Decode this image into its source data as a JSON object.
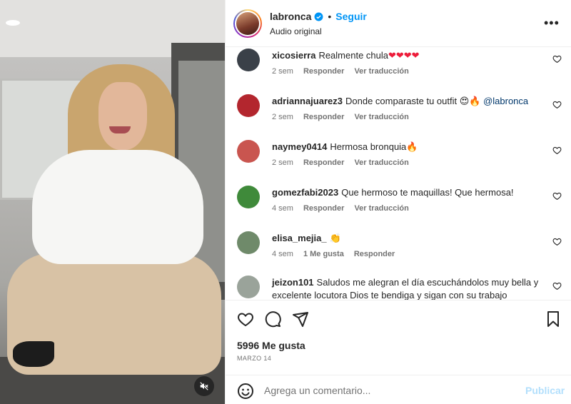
{
  "post": {
    "username": "labronca",
    "separator": "•",
    "follow_label": "Seguir",
    "audio_label": "Audio original",
    "more_label": "•••"
  },
  "comments": [
    {
      "user": "xicosierra",
      "text": "Realmente chula",
      "emoji": "❤❤❤❤",
      "time": "2 sem",
      "likes": "",
      "reply": "Responder",
      "translate": "Ver traducción",
      "avatar_color": "#3a4048"
    },
    {
      "user": "adriannajuarez3",
      "text": "Donde comparaste tu outfit 😍🔥",
      "mention": "@labronca",
      "time": "2 sem",
      "likes": "",
      "reply": "Responder",
      "translate": "Ver traducción",
      "avatar_color": "#b3262e"
    },
    {
      "user": "naymey0414",
      "text": "Hermosa bronquia🔥",
      "time": "2 sem",
      "likes": "",
      "reply": "Responder",
      "translate": "Ver traducción",
      "avatar_color": "#c9554f"
    },
    {
      "user": "gomezfabi2023",
      "text": "Que hermoso te maquillas! Que hermosa!",
      "time": "4 sem",
      "likes": "",
      "reply": "Responder",
      "translate": "Ver traducción",
      "avatar_color": "#3f8a3a"
    },
    {
      "user": "elisa_mejia_",
      "text": "👏",
      "time": "4 sem",
      "likes": "1 Me gusta",
      "reply": "Responder",
      "translate": "",
      "avatar_color": "#6f8a6a"
    },
    {
      "user": "jeizon101",
      "text": "Saludos me alegran el día escuchándolos muy bella y excelente locutora Dios te bendiga y sigan con su trabajo",
      "time": "",
      "likes": "",
      "reply": "",
      "translate": "",
      "avatar_color": "#9aa39a"
    }
  ],
  "actions": {
    "likes": "5996 Me gusta",
    "date": "MARZO 14"
  },
  "composer": {
    "placeholder": "Agrega un comentario...",
    "publish_label": "Publicar"
  }
}
